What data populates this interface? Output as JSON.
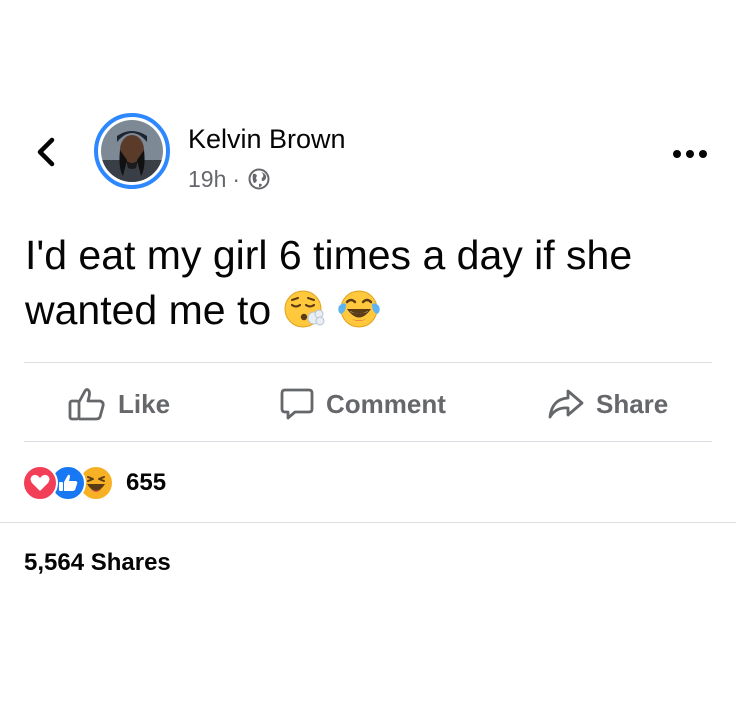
{
  "post": {
    "author_name": "Kelvin Brown",
    "time": "19h",
    "meta_separator": "·",
    "privacy_icon": "globe-icon",
    "text": "I'd eat my girl  6 times a day if she wanted me to",
    "text_emojis": [
      "face-exhaling-emoji",
      "tears-of-joy-emoji"
    ]
  },
  "actions": {
    "like_label": "Like",
    "comment_label": "Comment",
    "share_label": "Share"
  },
  "reactions": {
    "icons": [
      "love-reaction-icon",
      "like-reaction-icon",
      "haha-reaction-icon"
    ],
    "count": "655"
  },
  "shares": {
    "label": "5,564 Shares"
  },
  "colors": {
    "text": "#050505",
    "secondary_text": "#65676b",
    "avatar_ring": "#2d88ff",
    "like_blue": "#1877f2",
    "love_red": "#f33e58",
    "haha_yellow": "#f7b125",
    "divider": "#dadde1"
  }
}
